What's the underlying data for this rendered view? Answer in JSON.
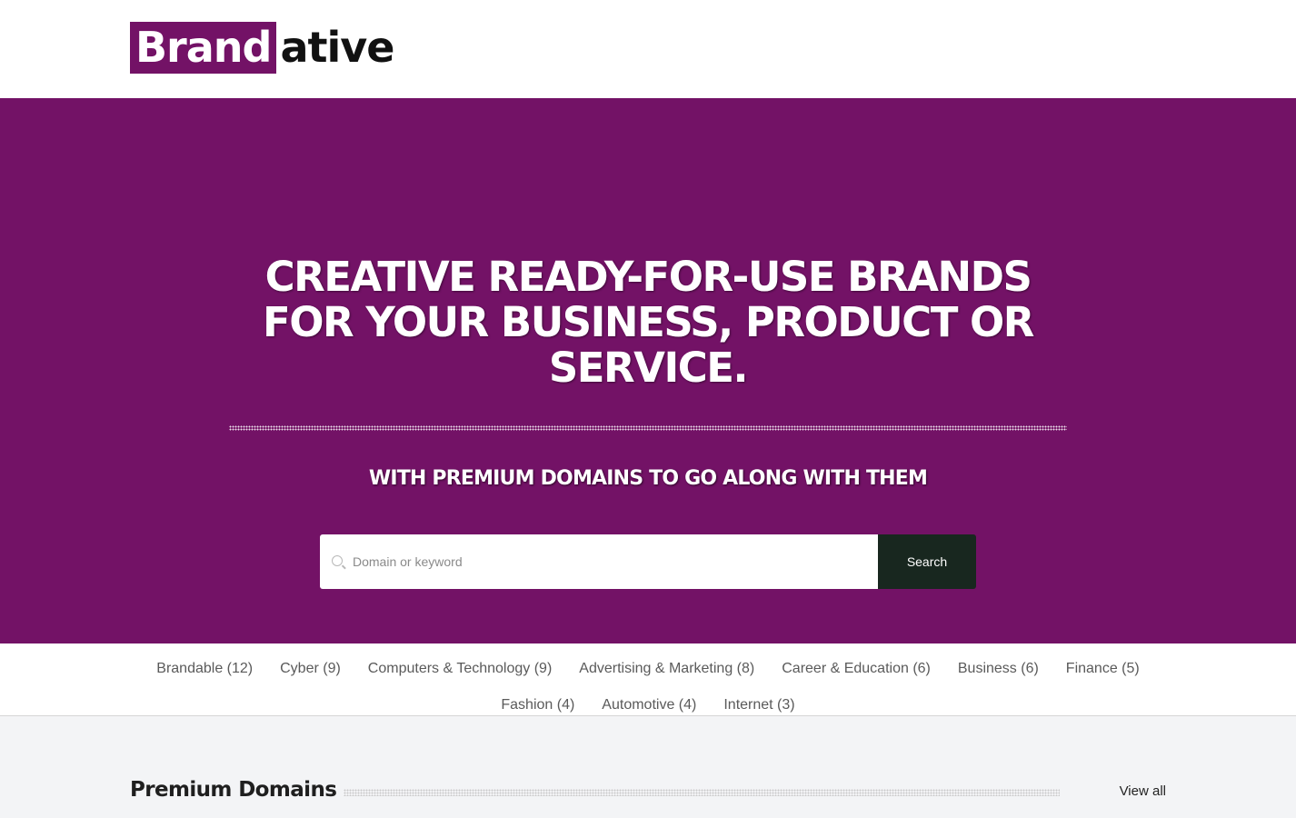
{
  "logo": {
    "part1": "Brand",
    "part2": "ative"
  },
  "hero": {
    "title": "CREATIVE READY-FOR-USE BRANDS FOR YOUR BUSINESS, PRODUCT OR SERVICE.",
    "subtitle": "WITH PREMIUM DOMAINS TO GO ALONG WITH THEM"
  },
  "search": {
    "placeholder": "Domain or keyword",
    "button_label": "Search"
  },
  "categories": {
    "row1": [
      "Brandable (12)",
      "Cyber (9)",
      "Computers & Technology (9)",
      "Advertising & Marketing (8)",
      "Career & Education (6)",
      "Business (6)",
      "Finance (5)"
    ],
    "row2": [
      "Fashion (4)",
      "Automotive (4)",
      "Internet (3)"
    ]
  },
  "premium": {
    "title": "Premium Domains",
    "view_all": "View all"
  },
  "colors": {
    "brand_purple": "#731266",
    "search_button": "#18271f",
    "page_background": "#f3f4f6"
  },
  "icons": {
    "search": "search-icon"
  }
}
